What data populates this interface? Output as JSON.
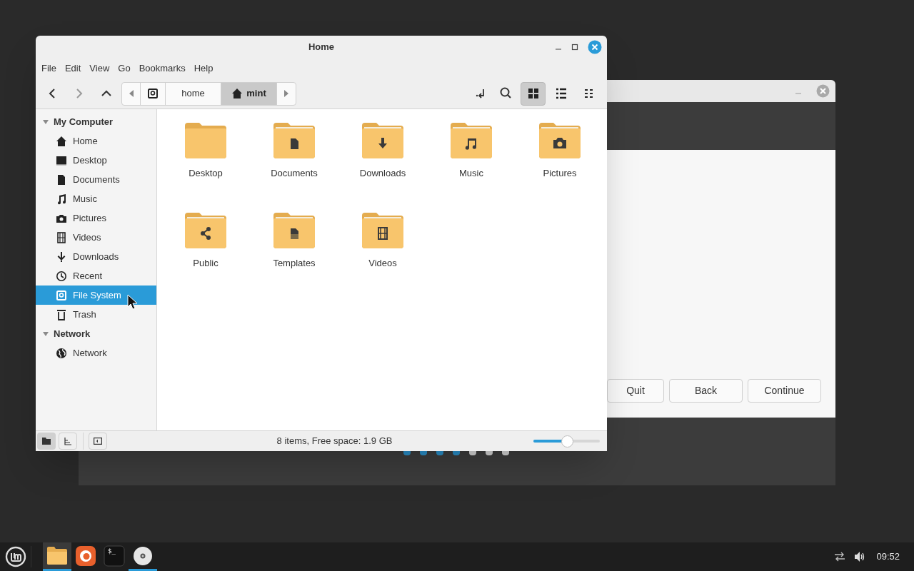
{
  "background_window": {
    "buttons": [
      {
        "label": "Quit"
      },
      {
        "label": "Back"
      },
      {
        "label": "Continue"
      }
    ],
    "progress_steps": [
      {
        "done": true
      },
      {
        "done": true
      },
      {
        "done": true
      },
      {
        "done": true
      },
      {
        "done": false
      },
      {
        "done": false
      },
      {
        "done": false
      }
    ]
  },
  "file_manager": {
    "window": {
      "title": "Home"
    },
    "menu": [
      "File",
      "Edit",
      "View",
      "Go",
      "Bookmarks",
      "Help"
    ],
    "breadcrumb": [
      {
        "kind": "filesystem",
        "selected": false
      },
      {
        "kind": "text",
        "label": "home",
        "selected": false
      },
      {
        "kind": "home",
        "label": "mint",
        "selected": true
      }
    ],
    "view_buttons": [
      {
        "kind": "grid",
        "selected": true
      },
      {
        "kind": "list",
        "selected": false
      },
      {
        "kind": "compact",
        "selected": false
      }
    ],
    "sidebar": {
      "sections": [
        {
          "label": "My Computer",
          "expanded": true,
          "children": [
            {
              "label": "Home",
              "kind": "home",
              "selected": false
            },
            {
              "label": "Desktop",
              "kind": "desktop",
              "selected": false
            },
            {
              "label": "Documents",
              "kind": "documents",
              "selected": false
            },
            {
              "label": "Music",
              "kind": "music",
              "selected": false
            },
            {
              "label": "Pictures",
              "kind": "pictures",
              "selected": false
            },
            {
              "label": "Videos",
              "kind": "videos",
              "selected": false
            },
            {
              "label": "Downloads",
              "kind": "downloads",
              "selected": false
            },
            {
              "label": "Recent",
              "kind": "recent",
              "selected": false
            },
            {
              "label": "File System",
              "kind": "filesystem",
              "selected": true
            },
            {
              "label": "Trash",
              "kind": "trash",
              "selected": false
            }
          ]
        },
        {
          "label": "Network",
          "expanded": true,
          "children": [
            {
              "label": "Network",
              "kind": "network",
              "selected": false
            }
          ]
        }
      ]
    },
    "files": [
      {
        "name": "Desktop",
        "kind": "plain"
      },
      {
        "name": "Documents",
        "kind": "documents"
      },
      {
        "name": "Downloads",
        "kind": "downloads"
      },
      {
        "name": "Music",
        "kind": "music"
      },
      {
        "name": "Pictures",
        "kind": "pictures"
      },
      {
        "name": "Public",
        "kind": "share"
      },
      {
        "name": "Templates",
        "kind": "templates"
      },
      {
        "name": "Videos",
        "kind": "videos"
      }
    ],
    "status_bar": {
      "text": "8 items, Free space: 1.9 GB",
      "zoom": {
        "level": 0.5
      }
    }
  },
  "taskbar": {
    "apps": [
      {
        "kind": "files",
        "running": true
      },
      {
        "kind": "firefox",
        "running": false
      },
      {
        "kind": "terminal",
        "label": "$_",
        "running": false
      },
      {
        "kind": "disc",
        "running": true
      }
    ],
    "clock": "09:52"
  }
}
